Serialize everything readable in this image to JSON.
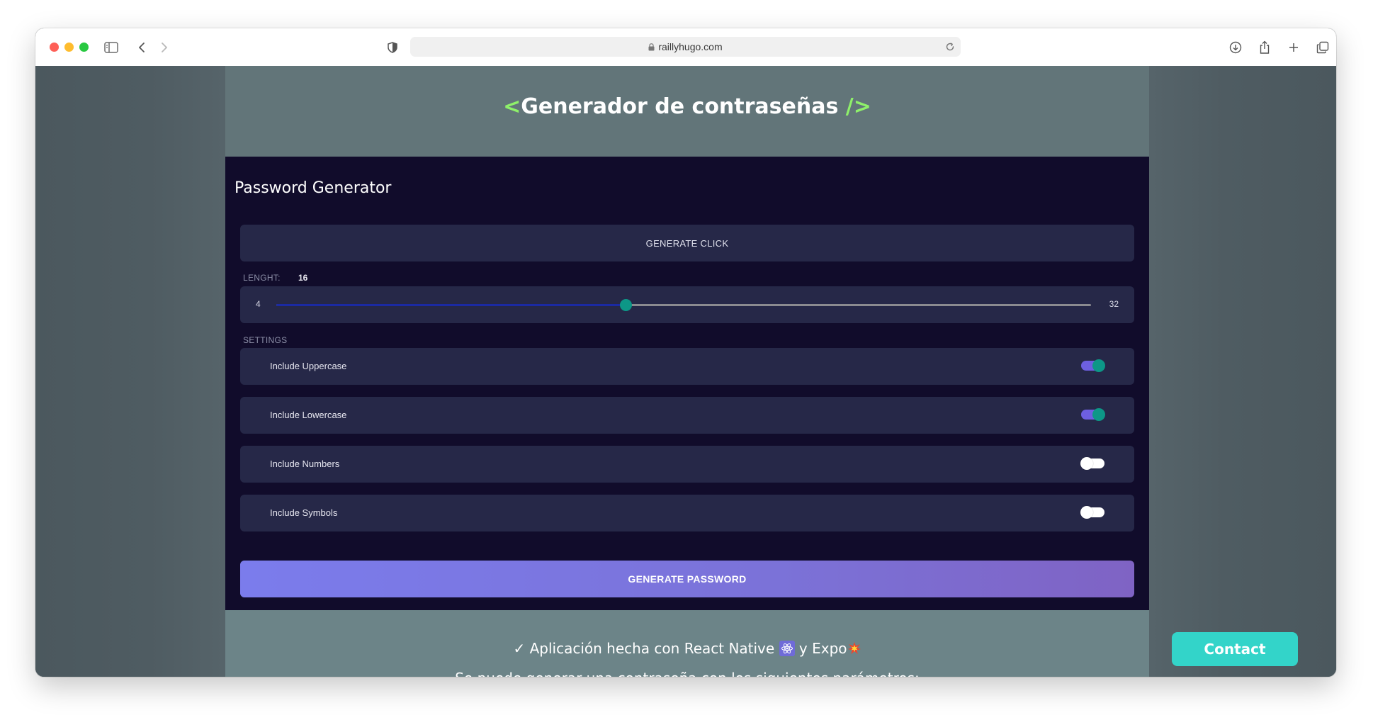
{
  "browser": {
    "url": "raillyhugo.com"
  },
  "hero": {
    "bracket_open": "<",
    "title": "Generador de contraseñas",
    "bracket_close": "/>"
  },
  "app": {
    "title": "Password Generator",
    "generate_click_label": "GENERATE CLICK",
    "length_label": "LENGHT:",
    "length_value": "16",
    "slider": {
      "min": 4,
      "max": 32,
      "value": 16,
      "min_label": "4",
      "max_label": "32"
    },
    "settings_label": "SETTINGS",
    "settings": [
      {
        "label": "Include Uppercase",
        "enabled": true
      },
      {
        "label": "Include Lowercase",
        "enabled": true
      },
      {
        "label": "Include Numbers",
        "enabled": false
      },
      {
        "label": "Include Symbols",
        "enabled": false
      }
    ],
    "generate_password_label": "GENERATE PASSWORD"
  },
  "info": {
    "check": "✓",
    "line1_prefix": "Aplicación hecha con React Native",
    "line1_middle": "y Expo",
    "line2": "Se puede generar una contraseña con los siguientes parámetros:"
  },
  "contact": {
    "label": "Contact"
  },
  "colors": {
    "accent_green": "#8ef06a",
    "toggle_on_track": "#6d5fe0",
    "toggle_on_knob": "#0d9787",
    "contact_bg": "#33d4c9",
    "panel_bg": "#110c2b",
    "card_bg": "#262848"
  }
}
